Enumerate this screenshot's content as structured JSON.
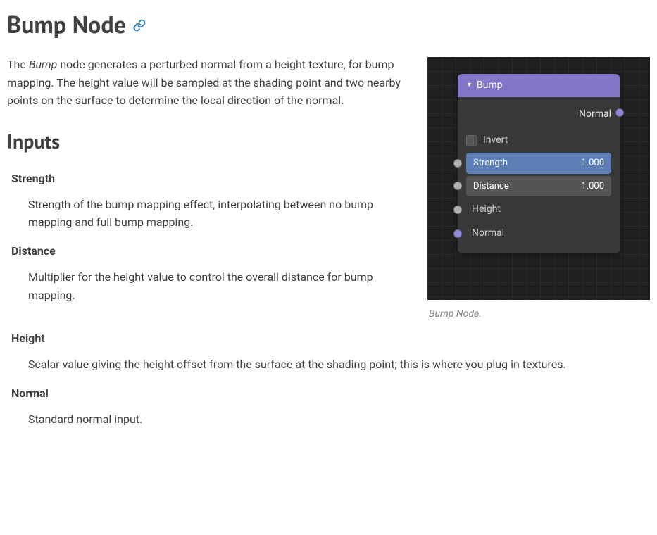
{
  "title": "Bump Node",
  "intro_before_em": "The ",
  "intro_em": "Bump",
  "intro_after_em": " node generates a perturbed normal from a height texture, for bump mapping. The height value will be sampled at the shading point and two nearby points on the surface to determine the local direction of the normal.",
  "inputs_heading": "Inputs",
  "terms": {
    "strength": {
      "label": "Strength",
      "desc": "Strength of the bump mapping effect, interpolating between no bump mapping and full bump mapping."
    },
    "distance": {
      "label": "Distance",
      "desc": "Multiplier for the height value to control the overall distance for bump mapping."
    },
    "height": {
      "label": "Height",
      "desc": "Scalar value giving the height offset from the surface at the shading point; this is where you plug in textures."
    },
    "normal": {
      "label": "Normal",
      "desc": "Standard normal input."
    }
  },
  "node": {
    "title": "Bump",
    "output": "Normal",
    "invert": "Invert",
    "strength_label": "Strength",
    "strength_value": "1.000",
    "distance_label": "Distance",
    "distance_value": "1.000",
    "height": "Height",
    "normal": "Normal"
  },
  "caption": "Bump Node."
}
